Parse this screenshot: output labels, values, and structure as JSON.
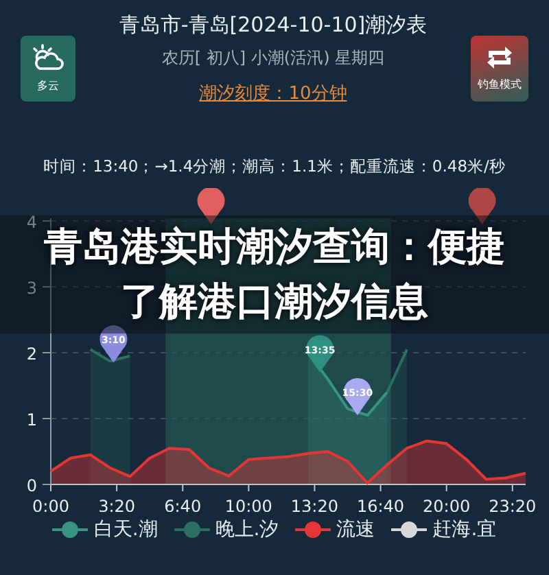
{
  "header": {
    "title": "青岛市-青岛[2024-10-10]潮汐表",
    "subtitle": "农历[ 初八] 小潮(活汛) 星期四",
    "link": "潮汐刻度：10分钟"
  },
  "weather_button": {
    "label": "多云"
  },
  "mode_button": {
    "label": "钓鱼模式"
  },
  "info": "时间：13:40；→1.4分潮；潮高：1.1米；配重流速：0.48米/秒",
  "chart_data": {
    "type": "area",
    "x": [
      0,
      1,
      2,
      3,
      4,
      5,
      6,
      7,
      8,
      9,
      10,
      11,
      12,
      13,
      14,
      15,
      16,
      17,
      18,
      19,
      20,
      21,
      22,
      23,
      24
    ],
    "xlim": [
      0,
      24
    ],
    "ylim": [
      0,
      4.04
    ],
    "grid": true,
    "xticks": [
      {
        "value": 0,
        "label": "0:00"
      },
      {
        "value": 3.333,
        "label": "3:20"
      },
      {
        "value": 6.667,
        "label": "6:40"
      },
      {
        "value": 10,
        "label": "10:00"
      },
      {
        "value": 13.333,
        "label": "13:20"
      },
      {
        "value": 16.667,
        "label": "16:40"
      },
      {
        "value": 20,
        "label": "20:00"
      },
      {
        "value": 23.333,
        "label": "23:20"
      }
    ],
    "yticks": [
      0,
      1,
      2,
      3,
      4
    ],
    "bands": [
      {
        "axis": "x",
        "from": 5.8,
        "to": 17.2
      }
    ],
    "series": [
      {
        "name": "白天.潮",
        "color": "#3a9483",
        "values": [
          null,
          null,
          null,
          null,
          null,
          null,
          null,
          null,
          null,
          null,
          null,
          null,
          null,
          2.0,
          1.6,
          1.15,
          1.05,
          1.4,
          null,
          null,
          null,
          null,
          null,
          null,
          null
        ]
      },
      {
        "name": "晚上.汐",
        "color": "#2b6e62",
        "values": [
          null,
          null,
          2.05,
          1.87,
          1.95,
          null,
          null,
          null,
          null,
          null,
          null,
          null,
          null,
          null,
          null,
          null,
          null,
          1.4,
          2.05,
          null,
          null,
          null,
          null,
          null,
          null
        ]
      },
      {
        "name": "流速",
        "color": "#e53535",
        "values": [
          0.2,
          0.4,
          0.45,
          0.25,
          0.12,
          0.4,
          0.55,
          0.53,
          0.25,
          0.13,
          0.38,
          0.4,
          0.42,
          0.47,
          0.5,
          0.35,
          0.02,
          0.3,
          0.55,
          0.66,
          0.62,
          0.38,
          0.08,
          0.1,
          0.17
        ]
      }
    ]
  },
  "legend_extra": [
    {
      "name": "赶海.宜",
      "color": "#d8d8d8"
    }
  ],
  "tide_markers": [
    {
      "label": "3:10",
      "color": "#8c8ce0"
    },
    {
      "color": "#e06060"
    },
    {
      "label": "13:35",
      "color": "#2f8f80"
    },
    {
      "label": "15:30",
      "color": "#a9a9f2"
    },
    {
      "color": "#b04545"
    }
  ],
  "overlay_caption": "青岛港实时潮汐查询：便捷了解港口潮汐信息"
}
